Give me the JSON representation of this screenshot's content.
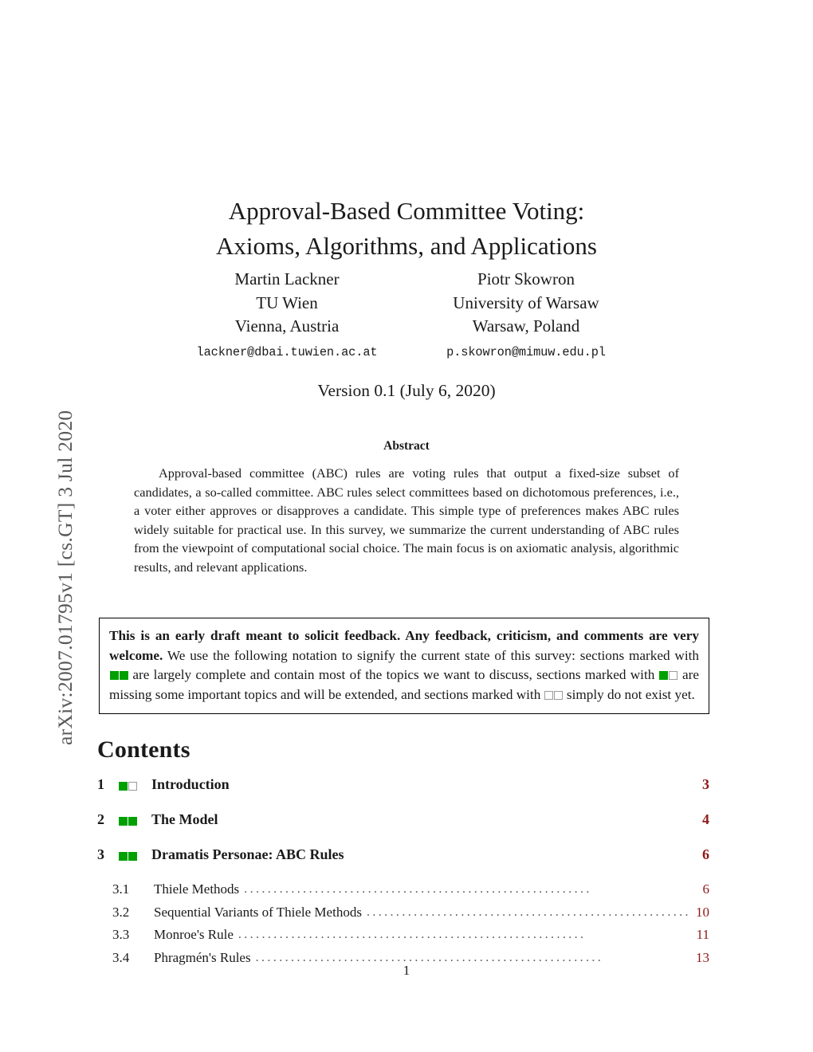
{
  "arxiv_stamp": "arXiv:2007.01795v1  [cs.GT]  3 Jul 2020",
  "paper": {
    "title_line1": "Approval-Based Committee Voting:",
    "title_line2": "Axioms, Algorithms, and Applications",
    "version": "Version 0.1 (July 6, 2020)",
    "page_number": "1"
  },
  "authors": [
    {
      "name": "Martin Lackner",
      "affiliation": "TU Wien",
      "location": "Vienna, Austria",
      "email": "lackner@dbai.tuwien.ac.at"
    },
    {
      "name": "Piotr Skowron",
      "affiliation": "University of Warsaw",
      "location": "Warsaw, Poland",
      "email": "p.skowron@mimuw.edu.pl"
    }
  ],
  "abstract": {
    "heading": "Abstract",
    "body": "Approval-based committee (ABC) rules are voting rules that output a fixed-size subset of candidates, a so-called committee. ABC rules select committees based on dichotomous preferences, i.e., a voter either approves or disapproves a candidate. This simple type of preferences makes ABC rules widely suitable for practical use. In this survey, we summarize the current understanding of ABC rules from the viewpoint of computational social choice. The main focus is on axiomatic analysis, algorithmic results, and relevant applications."
  },
  "notice": {
    "bold_lead": "This is an early draft meant to solicit feedback. Any feedback, criticism, and comments are very welcome.",
    "part1": " We use the following notation to signify the current state of this survey: sections marked with ",
    "part2": " are largely complete and contain most of the topics we want to discuss, sections marked with ",
    "part3": " are missing some important topics and will be extended, and sections marked with ",
    "part4": " simply do not exist yet."
  },
  "contents": {
    "heading": "Contents",
    "sections": [
      {
        "number": "1",
        "marker": "filled-empty",
        "title": "Introduction",
        "page": "3",
        "subsections": []
      },
      {
        "number": "2",
        "marker": "filled-filled",
        "title": "The Model",
        "page": "4",
        "subsections": []
      },
      {
        "number": "3",
        "marker": "filled-filled",
        "title": "Dramatis Personae: ABC Rules",
        "page": "6",
        "subsections": [
          {
            "number": "3.1",
            "title": "Thiele Methods",
            "page": "6"
          },
          {
            "number": "3.2",
            "title": "Sequential Variants of Thiele Methods",
            "page": "10"
          },
          {
            "number": "3.3",
            "title": "Monroe's Rule",
            "page": "11"
          },
          {
            "number": "3.4",
            "title": "Phragmén's Rules",
            "page": "13"
          }
        ]
      }
    ]
  },
  "colors": {
    "marker_green": "#00a000",
    "marker_empty_border": "#9b9b9b",
    "toc_page_link": "#901818",
    "stamp_gray": "#595959"
  }
}
